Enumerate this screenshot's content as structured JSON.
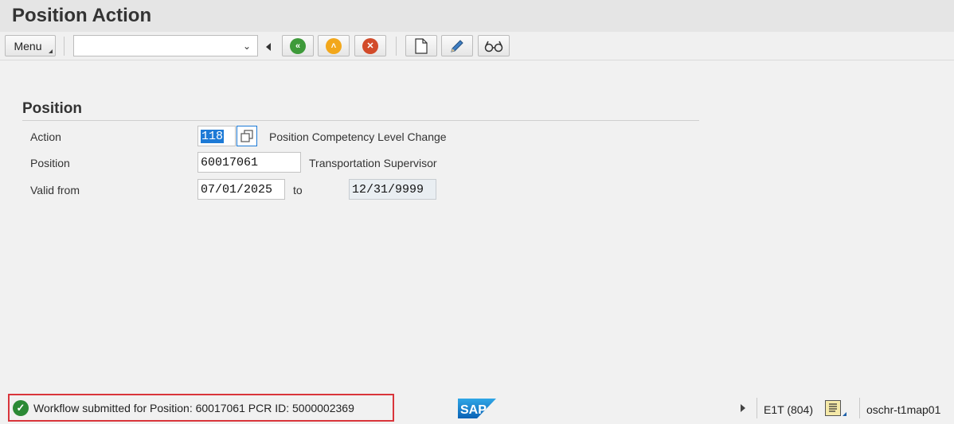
{
  "page": {
    "title": "Position Action"
  },
  "toolbar": {
    "menu_label": "Menu",
    "command_value": "",
    "buttons": [
      {
        "name": "back-icon",
        "color": "#3e9a3a"
      },
      {
        "name": "exit-icon",
        "color": "#f2a71b"
      },
      {
        "name": "cancel-icon",
        "color": "#d24b2a"
      },
      {
        "name": "new-document-icon"
      },
      {
        "name": "pencil-edit-icon"
      },
      {
        "name": "glasses-display-icon"
      }
    ]
  },
  "section": {
    "title": "Position",
    "action": {
      "label": "Action",
      "value": "118",
      "description": "Position Competency Level Change"
    },
    "position": {
      "label": "Position",
      "value": "60017061",
      "description": "Transportation Supervisor"
    },
    "valid": {
      "label": "Valid from",
      "from": "07/01/2025",
      "to_label": "to",
      "to": "12/31/9999"
    }
  },
  "statusbar": {
    "message": "Workflow submitted for Position: 60017061  PCR ID: 5000002369",
    "system": "E1T (804)",
    "server": "oschr-t1map01",
    "logo_text": "SAP"
  },
  "colors": {
    "accent": "#1d7ad6",
    "ok": "#2b8a35",
    "highlight": "#d9353b"
  }
}
